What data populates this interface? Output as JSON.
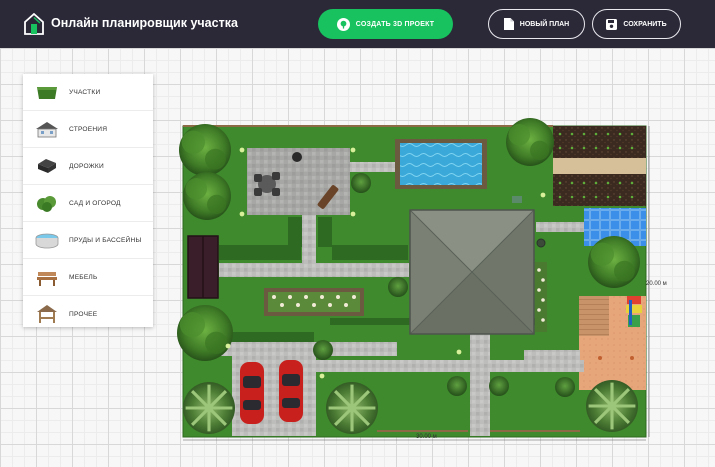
{
  "header": {
    "title": "Онлайн планировщик участка",
    "create_3d_label": "СОЗДАТЬ 3D ПРОЕКТ",
    "new_plan_label": "НОВЫЙ ПЛАН",
    "save_label": "СОХРАНИТЬ"
  },
  "sidebar": {
    "items": [
      {
        "label": "Участки",
        "icon": "turf-tile-icon"
      },
      {
        "label": "Строения",
        "icon": "house-icon"
      },
      {
        "label": "Дорожки",
        "icon": "paving-tile-icon"
      },
      {
        "label": "Сад и огород",
        "icon": "bush-icon"
      },
      {
        "label": "Пруды и бассейны",
        "icon": "pool-icon"
      },
      {
        "label": "Мебель",
        "icon": "bench-icon"
      },
      {
        "label": "Прочее",
        "icon": "gazebo-icon"
      }
    ]
  },
  "plan": {
    "width_label": "30.00 м",
    "height_label": "20.00 м"
  },
  "colors": {
    "header_bg": "#2b2938",
    "accent_green": "#17c25f",
    "lawn": "#3f8a2c",
    "paving": "#a9aaa7",
    "roof": "#7c8475",
    "pool": "#3aa8d8"
  }
}
